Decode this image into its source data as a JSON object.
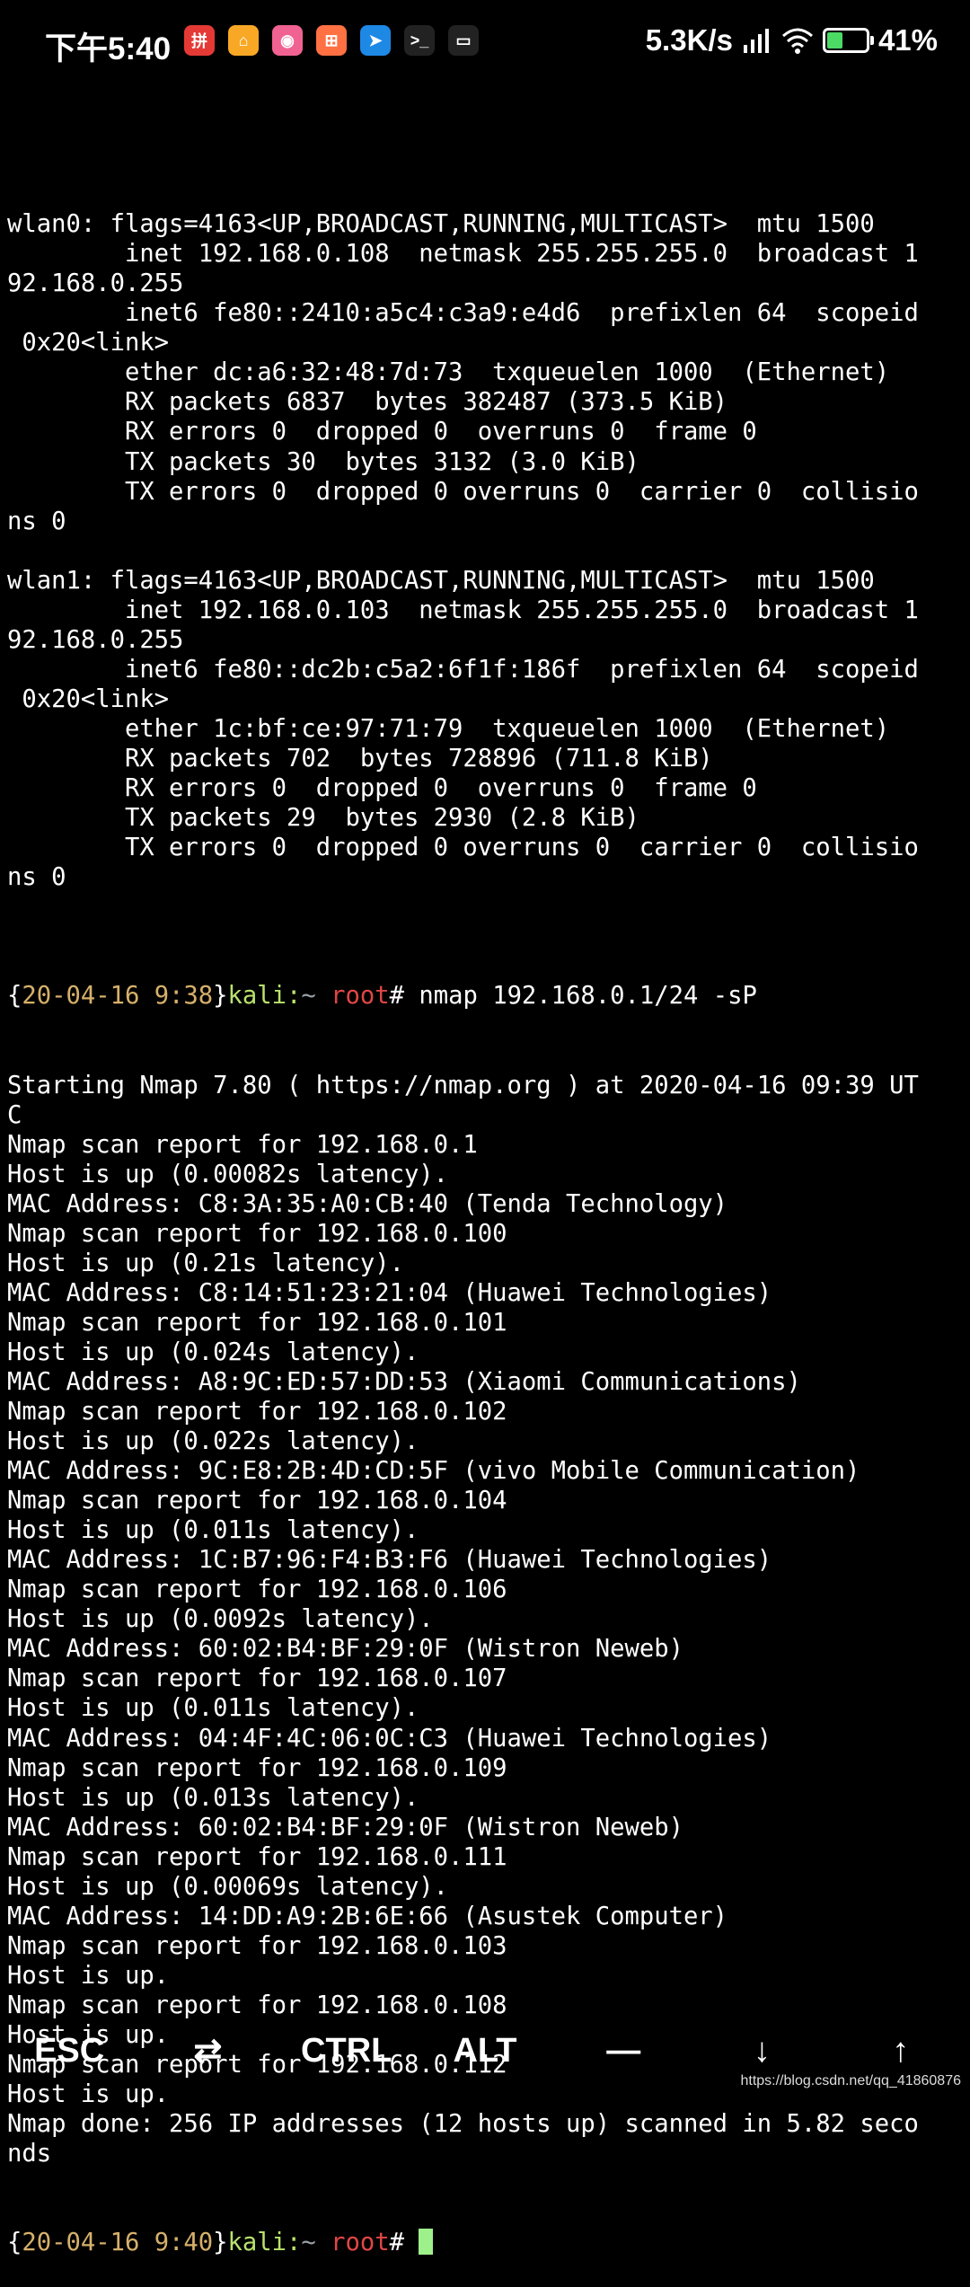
{
  "status_bar": {
    "time": "下午5:40",
    "notification_icons": [
      {
        "name": "app-icon-1",
        "glyph": "拼",
        "color": "#e53935"
      },
      {
        "name": "app-icon-2",
        "glyph": "⌂",
        "color": "#f9a825"
      },
      {
        "name": "app-icon-3",
        "glyph": "◉",
        "color": "#f06292"
      },
      {
        "name": "app-icon-4",
        "glyph": "⊞",
        "color": "#ff7043"
      },
      {
        "name": "app-icon-5",
        "glyph": "➤",
        "color": "#1e88e5"
      },
      {
        "name": "terminal-icon",
        "glyph": ">_",
        "color": "#222222"
      },
      {
        "name": "screen-icon",
        "glyph": "▭",
        "color": "#222222"
      }
    ],
    "net_speed": "5.3K/s",
    "battery_percent": 41,
    "battery_label": "41%"
  },
  "prompt": {
    "open": "{",
    "date": "20-04-16 9:38",
    "date2": "20-04-16 9:40",
    "close": "}",
    "host": "kali:",
    "tilde": "~",
    "user": " root",
    "hash": "# ",
    "command": "nmap 192.168.0.1/24 -sP"
  },
  "terminal_lines_before": [
    "",
    "wlan0: flags=4163<UP,BROADCAST,RUNNING,MULTICAST>  mtu 1500",
    "        inet 192.168.0.108  netmask 255.255.255.0  broadcast 1",
    "92.168.0.255",
    "        inet6 fe80::2410:a5c4:c3a9:e4d6  prefixlen 64  scopeid",
    " 0x20<link>",
    "        ether dc:a6:32:48:7d:73  txqueuelen 1000  (Ethernet)",
    "        RX packets 6837  bytes 382487 (373.5 KiB)",
    "        RX errors 0  dropped 0  overruns 0  frame 0",
    "        TX packets 30  bytes 3132 (3.0 KiB)",
    "        TX errors 0  dropped 0 overruns 0  carrier 0  collisio",
    "ns 0",
    "",
    "wlan1: flags=4163<UP,BROADCAST,RUNNING,MULTICAST>  mtu 1500",
    "        inet 192.168.0.103  netmask 255.255.255.0  broadcast 1",
    "92.168.0.255",
    "        inet6 fe80::dc2b:c5a2:6f1f:186f  prefixlen 64  scopeid",
    " 0x20<link>",
    "        ether 1c:bf:ce:97:71:79  txqueuelen 1000  (Ethernet)",
    "        RX packets 702  bytes 728896 (711.8 KiB)",
    "        RX errors 0  dropped 0  overruns 0  frame 0",
    "        TX packets 29  bytes 2930 (2.8 KiB)",
    "        TX errors 0  dropped 0 overruns 0  carrier 0  collisio",
    "ns 0",
    ""
  ],
  "terminal_lines_after": [
    "Starting Nmap 7.80 ( https://nmap.org ) at 2020-04-16 09:39 UT",
    "C",
    "Nmap scan report for 192.168.0.1",
    "Host is up (0.00082s latency).",
    "MAC Address: C8:3A:35:A0:CB:40 (Tenda Technology)",
    "Nmap scan report for 192.168.0.100",
    "Host is up (0.21s latency).",
    "MAC Address: C8:14:51:23:21:04 (Huawei Technologies)",
    "Nmap scan report for 192.168.0.101",
    "Host is up (0.024s latency).",
    "MAC Address: A8:9C:ED:57:DD:53 (Xiaomi Communications)",
    "Nmap scan report for 192.168.0.102",
    "Host is up (0.022s latency).",
    "MAC Address: 9C:E8:2B:4D:CD:5F (vivo Mobile Communication)",
    "Nmap scan report for 192.168.0.104",
    "Host is up (0.011s latency).",
    "MAC Address: 1C:B7:96:F4:B3:F6 (Huawei Technologies)",
    "Nmap scan report for 192.168.0.106",
    "Host is up (0.0092s latency).",
    "MAC Address: 60:02:B4:BF:29:0F (Wistron Neweb)",
    "Nmap scan report for 192.168.0.107",
    "Host is up (0.011s latency).",
    "MAC Address: 04:4F:4C:06:0C:C3 (Huawei Technologies)",
    "Nmap scan report for 192.168.0.109",
    "Host is up (0.013s latency).",
    "MAC Address: 60:02:B4:BF:29:0F (Wistron Neweb)",
    "Nmap scan report for 192.168.0.111",
    "Host is up (0.00069s latency).",
    "MAC Address: 14:DD:A9:2B:6E:66 (Asustek Computer)",
    "Nmap scan report for 192.168.0.103",
    "Host is up.",
    "Nmap scan report for 192.168.0.108",
    "Host is up.",
    "Nmap scan report for 192.168.0.112",
    "Host is up.",
    "Nmap done: 256 IP addresses (12 hosts up) scanned in 5.82 seco",
    "nds"
  ],
  "extra_keys": [
    {
      "name": "esc-key",
      "label": "ESC"
    },
    {
      "name": "tab-key",
      "label": "⇄"
    },
    {
      "name": "ctrl-key",
      "label": "CTRL"
    },
    {
      "name": "alt-key",
      "label": "ALT"
    },
    {
      "name": "dash-key",
      "label": "—"
    },
    {
      "name": "arrow-down-key",
      "label": "↓"
    },
    {
      "name": "arrow-up-key",
      "label": "↑"
    }
  ],
  "watermark": "https://blog.csdn.net/qq_41860876"
}
